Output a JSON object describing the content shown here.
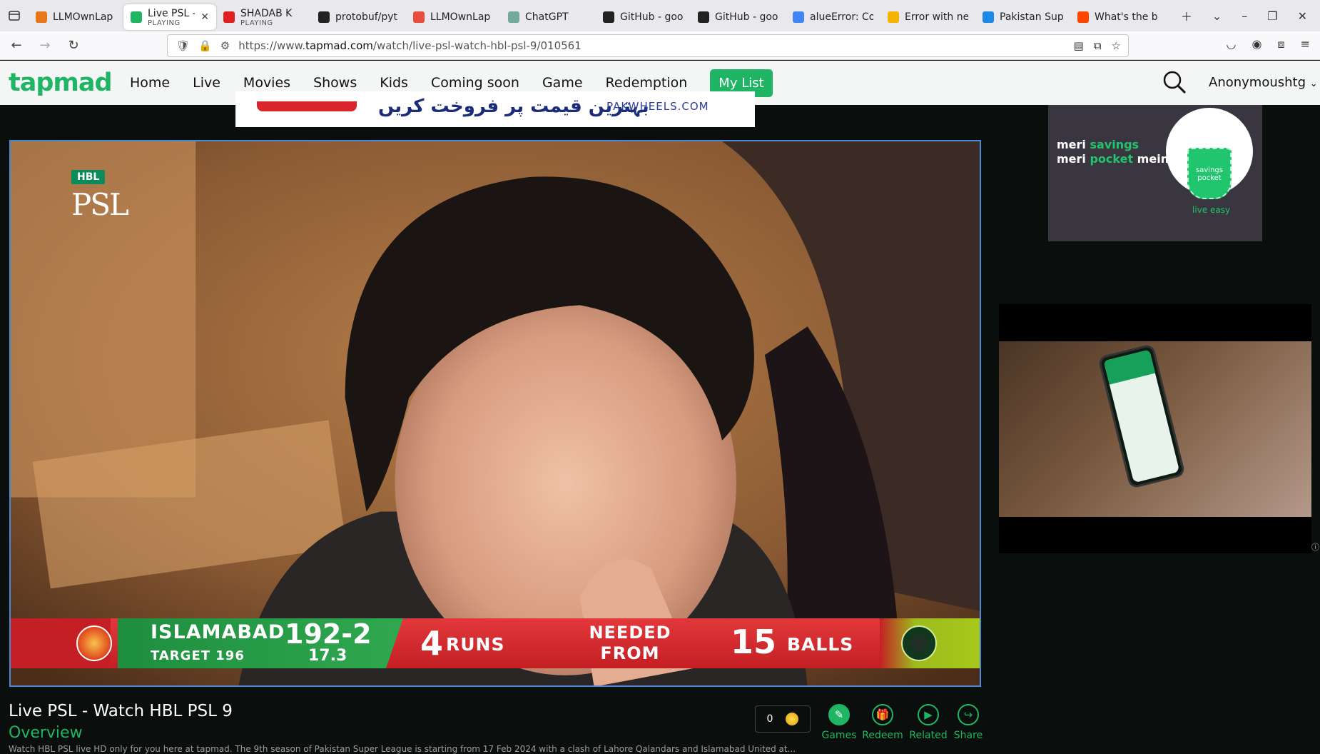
{
  "browser": {
    "tabs": [
      {
        "label": "LLMOwnLap",
        "sub": "",
        "icon_color": "#e8771b",
        "active": false
      },
      {
        "label": "Live PSL - W",
        "sub": "PLAYING",
        "icon_color": "#1fb564",
        "active": true
      },
      {
        "label": "SHADAB K",
        "sub": "PLAYING",
        "icon_color": "#e02020",
        "active": false
      },
      {
        "label": "protobuf/pyt",
        "sub": "",
        "icon_color": "#222222",
        "active": false
      },
      {
        "label": "LLMOwnLap",
        "sub": "",
        "icon_color": "#e84c3d",
        "active": false
      },
      {
        "label": "ChatGPT",
        "sub": "",
        "icon_color": "#74aa9c",
        "active": false
      },
      {
        "label": "GitHub - goo",
        "sub": "",
        "icon_color": "#222222",
        "active": false
      },
      {
        "label": "GitHub - goo",
        "sub": "",
        "icon_color": "#222222",
        "active": false
      },
      {
        "label": "alueError: Co",
        "sub": "",
        "icon_color": "#4285f4",
        "active": false
      },
      {
        "label": "Error with ne",
        "sub": "",
        "icon_color": "#f4b400",
        "active": false
      },
      {
        "label": "Pakistan Sup",
        "sub": "",
        "icon_color": "#1e88e5",
        "active": false
      },
      {
        "label": "What's the b",
        "sub": "",
        "icon_color": "#ff4500",
        "active": false
      }
    ],
    "url_prefix": "https://www.",
    "url_host": "tapmad.com",
    "url_path": "/watch/live-psl-watch-hbl-psl-9/010561"
  },
  "site": {
    "logo": "tapmad",
    "menu": [
      "Home",
      "Live",
      "Movies",
      "Shows",
      "Kids",
      "Coming soon",
      "Game",
      "Redemption"
    ],
    "my_list": "My List",
    "user": "Anonymoushtg"
  },
  "banner_ad": {
    "urdu_text": "بہترین قیمت پر فروخت کریں",
    "site": "PAKWHEELS.COM"
  },
  "player": {
    "hbl_tag": "HBL",
    "psl_word": "PSL",
    "scoreboard": {
      "team": "ISLAMABAD",
      "score": "192-2",
      "target": "TARGET 196",
      "overs": "17.3",
      "runs_needed": "4",
      "runs_word": "RUNS",
      "needed_from": "NEEDED FROM",
      "balls": "15",
      "balls_word": "BALLS"
    }
  },
  "ads": {
    "savings_line1_a": "meri ",
    "savings_line1_b": "savings",
    "savings_line2_a": "meri ",
    "savings_line2_b": "pocket",
    "savings_line2_c": " mein",
    "pocket_text": "savings pocket",
    "tagline": "live easy"
  },
  "video_info": {
    "title": "Live PSL - Watch HBL PSL 9",
    "overview": "Overview",
    "description": "Watch HBL PSL live HD only for you here at tapmad. The 9th season of Pakistan Super League is starting from 17 Feb 2024 with a clash of Lahore Qalandars and Islamabad United at...",
    "coins": "0",
    "actions": [
      "Games",
      "Redeem",
      "Related",
      "Share"
    ]
  },
  "colors": {
    "brand": "#1fb564",
    "page_bg": "#0a0f0d",
    "score_red": "#c41f24",
    "score_green": "#2fa84f"
  }
}
